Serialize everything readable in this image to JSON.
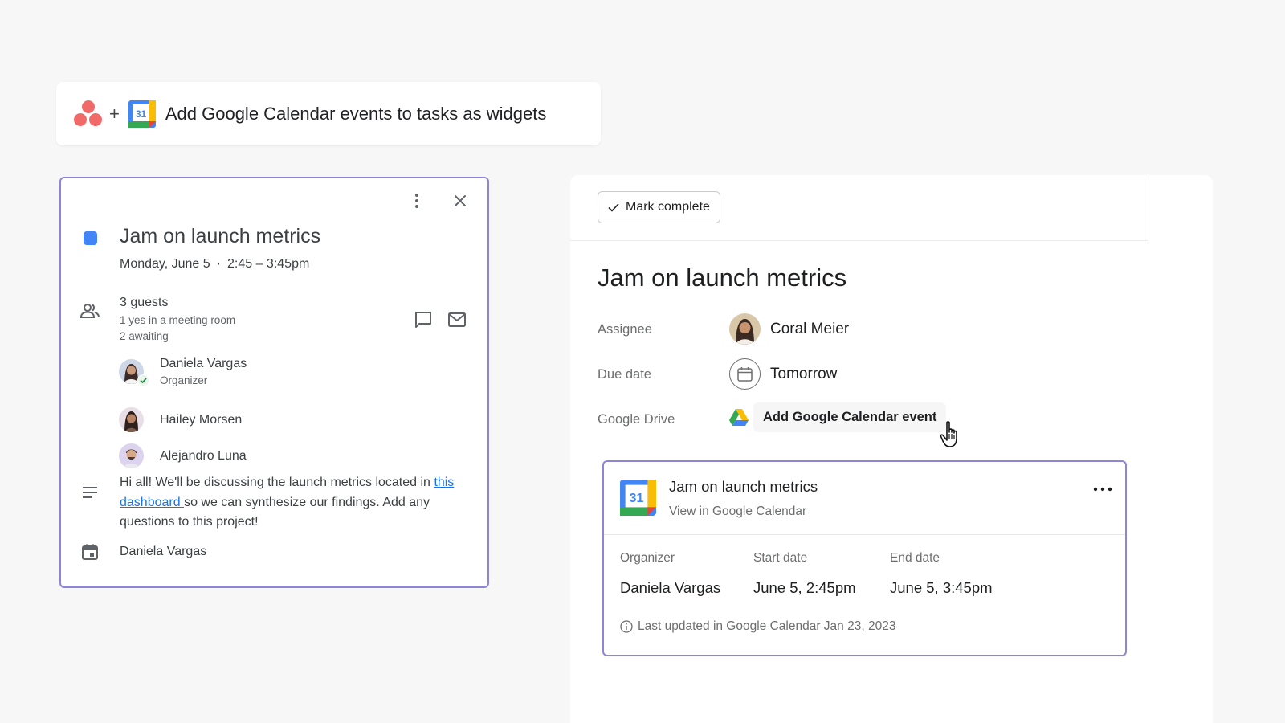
{
  "banner": {
    "plus": "+",
    "calendar_day": "31",
    "title": "Add Google Calendar events to tasks as widgets"
  },
  "event": {
    "title": "Jam on launch metrics",
    "date": "Monday, June 5",
    "separator": "·",
    "time": "2:45 – 3:45pm",
    "guests": {
      "count": "3 guests",
      "summary_yes": "1 yes in a meeting room",
      "summary_awaiting": "2 awaiting",
      "list": [
        {
          "name": "Daniela Vargas",
          "role": "Organizer"
        },
        {
          "name": "Hailey Morsen"
        },
        {
          "name": "Alejandro Luna"
        }
      ]
    },
    "description": {
      "before": "Hi all! We'll be discussing the launch metrics located in ",
      "link": "this dashboard ",
      "after": "so we can synthesize our findings. Add any questions to this project!"
    },
    "calendar_owner": "Daniela Vargas",
    "color": "#4285f4"
  },
  "task": {
    "mark_complete": "Mark complete",
    "title": "Jam on launch metrics",
    "fields": {
      "assignee_label": "Assignee",
      "assignee_value": "Coral Meier",
      "due_label": "Due date",
      "due_value": "Tomorrow",
      "drive_label": "Google Drive",
      "drive_action": "Add Google Calendar event"
    },
    "widget": {
      "calendar_day": "31",
      "title": "Jam on launch metrics",
      "link": "View in Google Calendar",
      "organizer_label": "Organizer",
      "organizer_value": "Daniela Vargas",
      "start_label": "Start date",
      "start_value": "June 5, 2:45pm",
      "end_label": "End date",
      "end_value": "June 5, 3:45pm",
      "footer": "Last updated in Google Calendar Jan 23, 2023"
    }
  },
  "colors": {
    "asana": "#f06a6a",
    "highlight_border": "#8e85d8",
    "link": "#1a73e8",
    "gcal_blue": "#4285f4",
    "gcal_green": "#34a853",
    "gcal_yellow": "#fbbc04",
    "gcal_red": "#ea4335"
  },
  "icons": [
    "asana-logo",
    "google-calendar-icon",
    "more-vert-icon",
    "close-icon",
    "people-icon",
    "chat-icon",
    "mail-icon",
    "notes-icon",
    "calendar-icon",
    "check-icon",
    "google-drive-icon",
    "hand-cursor-icon",
    "more-horiz-icon",
    "info-icon"
  ]
}
